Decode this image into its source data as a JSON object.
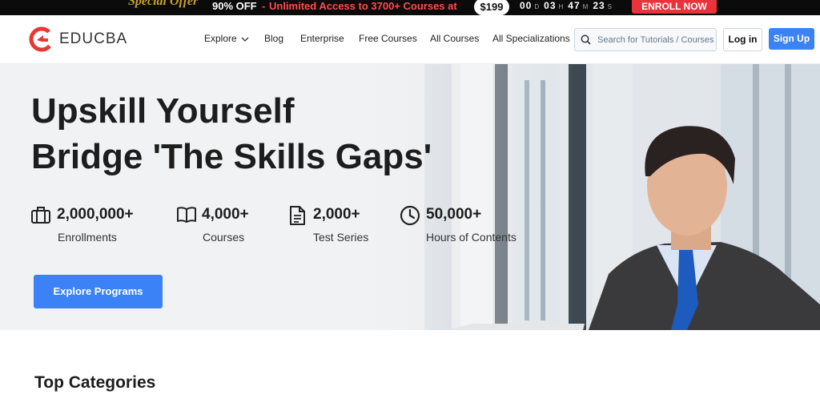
{
  "promo": {
    "special": "Special Offer",
    "discount": "90% OFF",
    "separator": "-",
    "access": "Unlimited Access to 3700+ Courses at",
    "price": "$199",
    "timer": {
      "days": "00",
      "days_unit": "D",
      "hours": "03",
      "hours_unit": "H",
      "minutes": "47",
      "minutes_unit": "M",
      "seconds": "23",
      "seconds_unit": "S"
    },
    "enroll": "ENROLL NOW"
  },
  "nav": {
    "brand": "EDUCBA",
    "links": [
      "Explore",
      "Blog",
      "Enterprise",
      "Free Courses",
      "All Courses",
      "All Specializations"
    ],
    "search_placeholder": "Search for Tutorials / Courses",
    "login": "Log in",
    "signup": "Sign Up"
  },
  "hero": {
    "title_line1": "Upskill Yourself",
    "title_line2": "Bridge 'The Skills Gaps'",
    "stats": [
      {
        "value": "2,000,000+",
        "label": "Enrollments",
        "icon": "briefcase-icon"
      },
      {
        "value": "4,000+",
        "label": "Courses",
        "icon": "book-icon"
      },
      {
        "value": "2,000+",
        "label": "Test Series",
        "icon": "document-icon"
      },
      {
        "value": "50,000+",
        "label": "Hours of Contents",
        "icon": "clock-icon"
      }
    ],
    "cta": "Explore Programs"
  },
  "sections": {
    "top_categories": "Top Categories"
  },
  "colors": {
    "accent": "#3b82f6",
    "promo_red": "#e8333a",
    "logo_red": "#e53935"
  }
}
